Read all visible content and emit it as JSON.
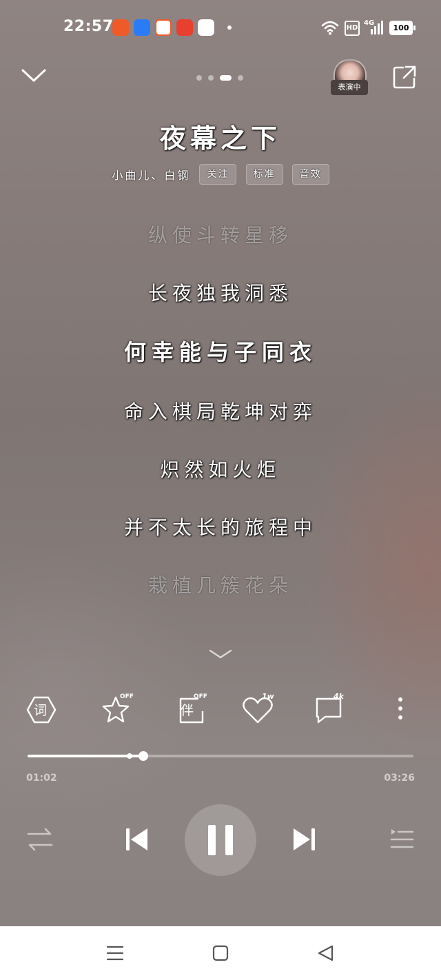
{
  "status_bar": {
    "time": "22:57",
    "hd_label": "HD",
    "network_label": "4G",
    "battery": "100"
  },
  "top_nav": {
    "avatar_badge": "表演中"
  },
  "song": {
    "title": "夜幕之下",
    "artists": "小曲儿、白钢",
    "chips": [
      "关注",
      "标准",
      "音效"
    ]
  },
  "lyrics": [
    "纵使斗转星移",
    "长夜独我洞悉",
    "何幸能与子同衣",
    "命入棋局乾坤对弈",
    "炽然如火炬",
    "并不太长的旅程中",
    "栽植几簇花朵"
  ],
  "actions": {
    "lyrics_label": "词",
    "favorite_tag": "OFF",
    "accompany_label": "伴",
    "accompany_tag": "OFF",
    "like_count": "1w",
    "comment_count": "4k"
  },
  "playback": {
    "current_time": "01:02",
    "total_time": "03:26",
    "progress_fraction": 0.3,
    "buffer_fraction": 0.265
  },
  "colors": {
    "accent": "#ffffff",
    "background": "#857c7a"
  }
}
